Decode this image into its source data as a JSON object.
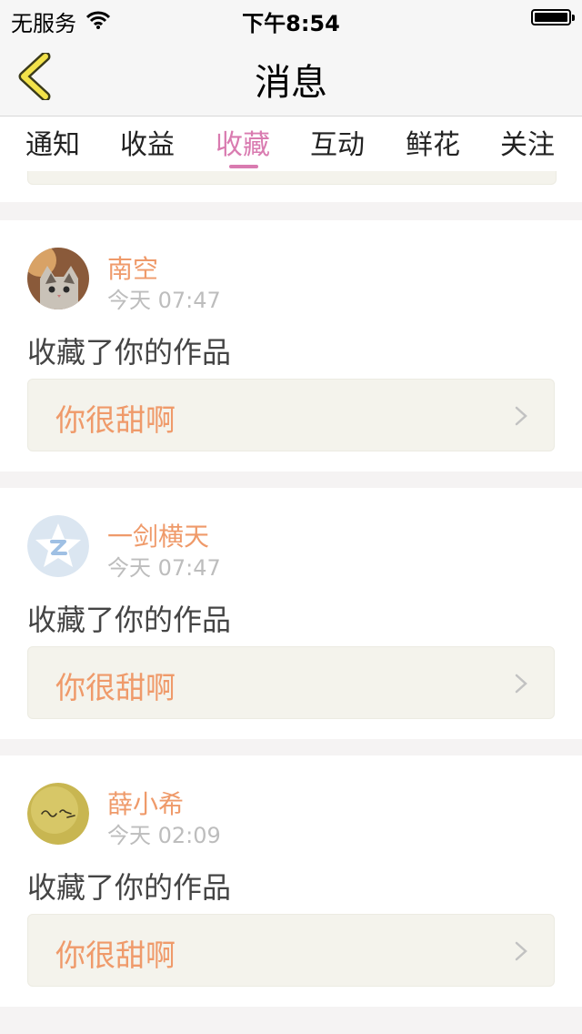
{
  "status_bar": {
    "carrier": "无服务",
    "time": "下午8:54"
  },
  "header": {
    "title": "消息"
  },
  "tabs": [
    {
      "label": "通知"
    },
    {
      "label": "收益"
    },
    {
      "label": "收藏",
      "active": true
    },
    {
      "label": "互动"
    },
    {
      "label": "鲜花"
    },
    {
      "label": "关注"
    }
  ],
  "messages": [
    {
      "user": "南空",
      "time": "今天 07:47",
      "action": "收藏了你的作品",
      "work": "你很甜啊",
      "avatar": "cat-photo"
    },
    {
      "user": "一剑横天",
      "time": "今天 07:47",
      "action": "收藏了你的作品",
      "work": "你很甜啊",
      "avatar": "qq-default-avatar"
    },
    {
      "user": "薛小希",
      "time": "今天 02:09",
      "action": "收藏了你的作品",
      "work": "你很甜啊",
      "avatar": "handwriting-photo"
    }
  ],
  "colors": {
    "accent": "#d97bb0",
    "name": "#ef9a6a",
    "muted": "#bdbdbd"
  }
}
